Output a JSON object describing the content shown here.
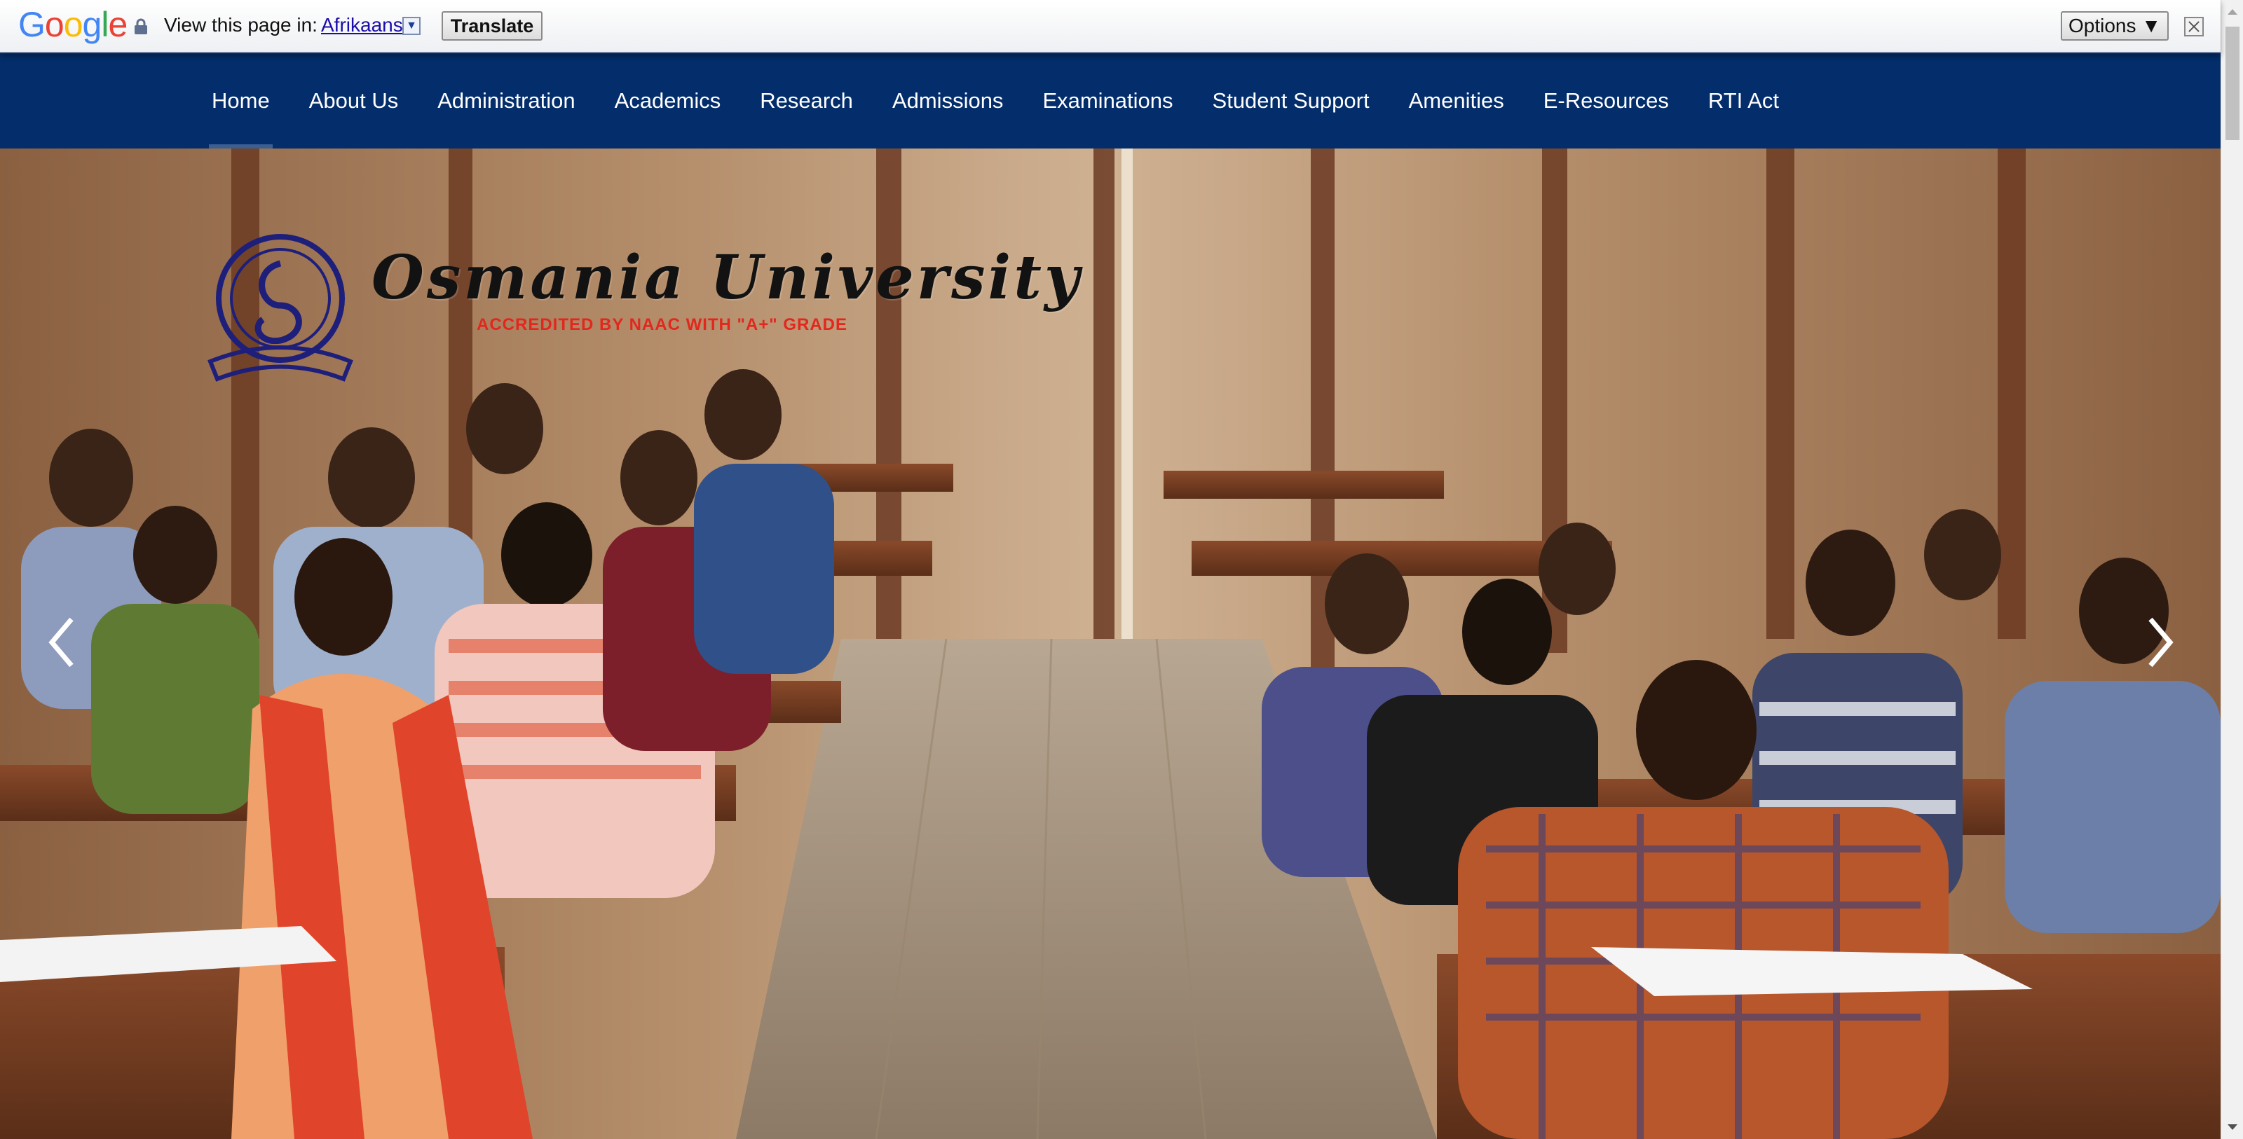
{
  "translate_bar": {
    "brand": "Google",
    "view_label": "View this page in:",
    "language": "Afrikaans",
    "dropdown_glyph": "▼",
    "translate_button": "Translate",
    "options_button": "Options ▼",
    "icons": [
      "lock-icon",
      "dropdown-icon",
      "close-icon"
    ]
  },
  "nav": {
    "items": [
      {
        "label": "Home",
        "active": true
      },
      {
        "label": "About Us"
      },
      {
        "label": "Administration"
      },
      {
        "label": "Academics"
      },
      {
        "label": "Research"
      },
      {
        "label": "Admissions"
      },
      {
        "label": "Examinations"
      },
      {
        "label": "Student Support"
      },
      {
        "label": "Amenities"
      },
      {
        "label": "E-Resources"
      },
      {
        "label": "RTI Act"
      }
    ]
  },
  "hero": {
    "title": "Osmania University",
    "subtitle": "ACCREDITED BY NAAC WITH \"A+\" GRADE",
    "seal_icon": "university-seal-logo",
    "prev_icon": "chevron-left-icon",
    "next_icon": "chevron-right-icon"
  },
  "colors": {
    "nav_bg": "#032d6b",
    "nav_text": "#ffffff",
    "subtitle_red": "#e3271d",
    "link_blue": "#1a0dab"
  }
}
